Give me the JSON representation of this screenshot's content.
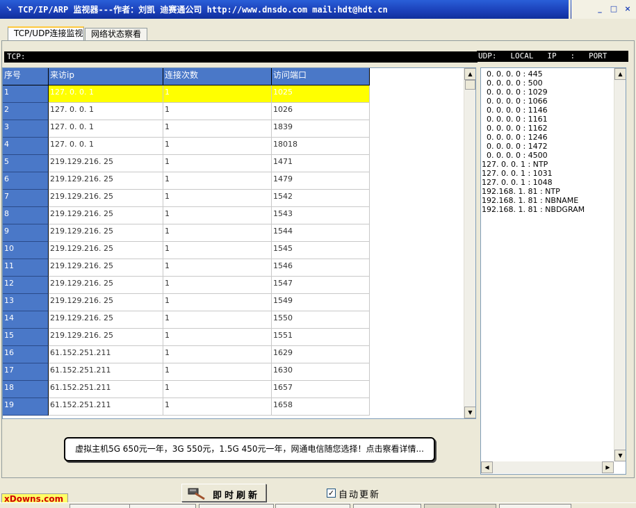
{
  "window": {
    "title": "TCP/IP/ARP 监视器---作者：刘凯 迪赛通公司 http://www.dnsdo.com mail:hdt@hdt.cn",
    "app_icon": "arrow-icon",
    "buttons": {
      "minimize": "_",
      "maximize": "□",
      "close": "×"
    }
  },
  "tabs": [
    {
      "label": "TCP/UDP连接监视",
      "active": true
    },
    {
      "label": "网络状态察看",
      "active": false
    }
  ],
  "tcp_header": "TCP:",
  "udp_header": "UDP:   LOCAL   IP   :   PORT",
  "table": {
    "columns": [
      "序号",
      "来访ip",
      "连接次数",
      "访问端口"
    ],
    "selected_row": 0,
    "rows": [
      [
        "1",
        "127. 0. 0. 1",
        "1",
        "1025"
      ],
      [
        "2",
        "127. 0. 0. 1",
        "1",
        "1026"
      ],
      [
        "3",
        "127. 0. 0. 1",
        "1",
        "1839"
      ],
      [
        "4",
        "127. 0. 0. 1",
        "1",
        "18018"
      ],
      [
        "5",
        "219.129.216. 25",
        "1",
        "1471"
      ],
      [
        "6",
        "219.129.216. 25",
        "1",
        "1479"
      ],
      [
        "7",
        "219.129.216. 25",
        "1",
        "1542"
      ],
      [
        "8",
        "219.129.216. 25",
        "1",
        "1543"
      ],
      [
        "9",
        "219.129.216. 25",
        "1",
        "1544"
      ],
      [
        "10",
        "219.129.216. 25",
        "1",
        "1545"
      ],
      [
        "11",
        "219.129.216. 25",
        "1",
        "1546"
      ],
      [
        "12",
        "219.129.216. 25",
        "1",
        "1547"
      ],
      [
        "13",
        "219.129.216. 25",
        "1",
        "1549"
      ],
      [
        "14",
        "219.129.216. 25",
        "1",
        "1550"
      ],
      [
        "15",
        "219.129.216. 25",
        "1",
        "1551"
      ],
      [
        "16",
        " 61.152.251.211",
        "1",
        "1629"
      ],
      [
        "17",
        " 61.152.251.211",
        "1",
        "1630"
      ],
      [
        "18",
        " 61.152.251.211",
        "1",
        "1657"
      ],
      [
        "19",
        " 61.152.251.211",
        "1",
        "1658"
      ]
    ]
  },
  "udp_list": [
    "  0. 0. 0. 0 : 445",
    "  0. 0. 0. 0 : 500",
    "  0. 0. 0. 0 : 1029",
    "  0. 0. 0. 0 : 1066",
    "  0. 0. 0. 0 : 1146",
    "  0. 0. 0. 0 : 1161",
    "  0. 0. 0. 0 : 1162",
    "  0. 0. 0. 0 : 1246",
    "  0. 0. 0. 0 : 1472",
    "  0. 0. 0. 0 : 4500",
    "127. 0. 0. 1 : NTP",
    "127. 0. 0. 1 : 1031",
    "127. 0. 0. 1 : 1048",
    "192.168. 1. 81 : NTP",
    "192.168. 1. 81 : NBNAME",
    "192.168. 1. 81 : NBDGRAM"
  ],
  "banner": "虚拟主机5G 650元一年，3G 550元，1.5G 450元一年，网通电信随您选择！点击察看详情...",
  "refresh_button": {
    "label": "即时刷新",
    "icon": "hammer-icon"
  },
  "auto_update": {
    "label": "自动更新",
    "checked": true,
    "check_glyph": "✓"
  },
  "watermark": "xDowns.com",
  "scroll_arrows": {
    "up": "▲",
    "down": "▼",
    "left": "◀",
    "right": "▶"
  },
  "colors": {
    "header_blue": "#4a78c8",
    "selected_row": "#ffff00",
    "title_bar": "#1a3fb8"
  }
}
